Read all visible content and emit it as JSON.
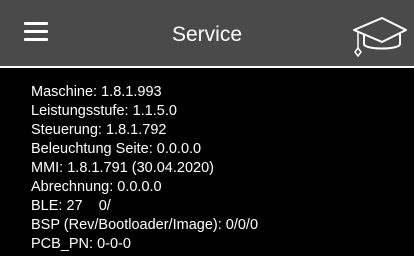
{
  "header": {
    "title": "Service"
  },
  "icons": {
    "menu": "hamburger-menu-icon",
    "training": "graduation-cap-icon"
  },
  "info": {
    "lines": [
      "Maschine: 1.8.1.993",
      "Leistungsstufe: 1.1.5.0",
      "Steuerung: 1.8.1.792",
      "Beleuchtung Seite: 0.0.0.0",
      "MMI: 1.8.1.791 (30.04.2020)",
      "Abrechnung: 0.0.0.0",
      "BLE: 27    0/",
      "BSP (Rev/Bootloader/Image): 0/0/0",
      "PCB_PN: 0-0-0"
    ]
  },
  "colors": {
    "header_background": "#4a4a4a",
    "page_background": "#000000",
    "text": "#ffffff"
  }
}
